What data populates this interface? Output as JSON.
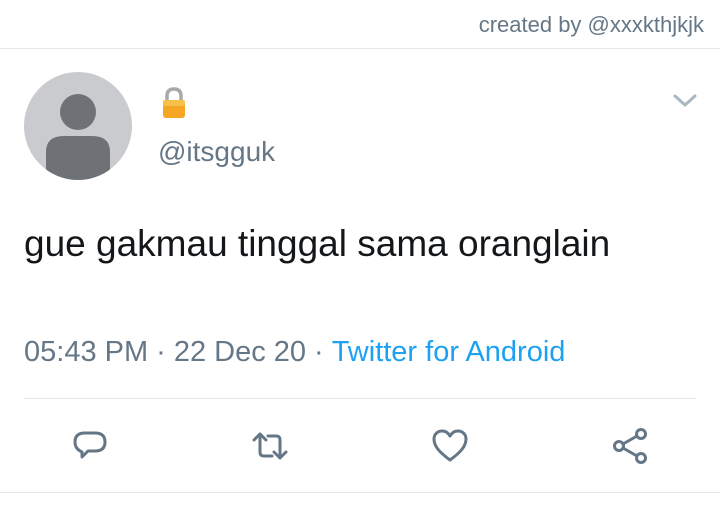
{
  "credit": "created by @xxxkthjkjk",
  "tweet": {
    "protected_icon": "lock-icon",
    "handle": "@itsgguk",
    "text": "gue gakmau tinggal sama oranglain",
    "time": "05:43 PM",
    "date": "22 Dec 20",
    "separator": "·",
    "source": "Twitter for Android"
  },
  "actions": [
    "reply-icon",
    "retweet-icon",
    "like-icon",
    "share-icon"
  ],
  "colors": {
    "secondary_text": "#657786",
    "link": "#1da1f2",
    "icon": "#657786",
    "divider": "#e1e8ed",
    "avatar_bg": "#c9cbce",
    "avatar_fg": "#6e7176"
  }
}
